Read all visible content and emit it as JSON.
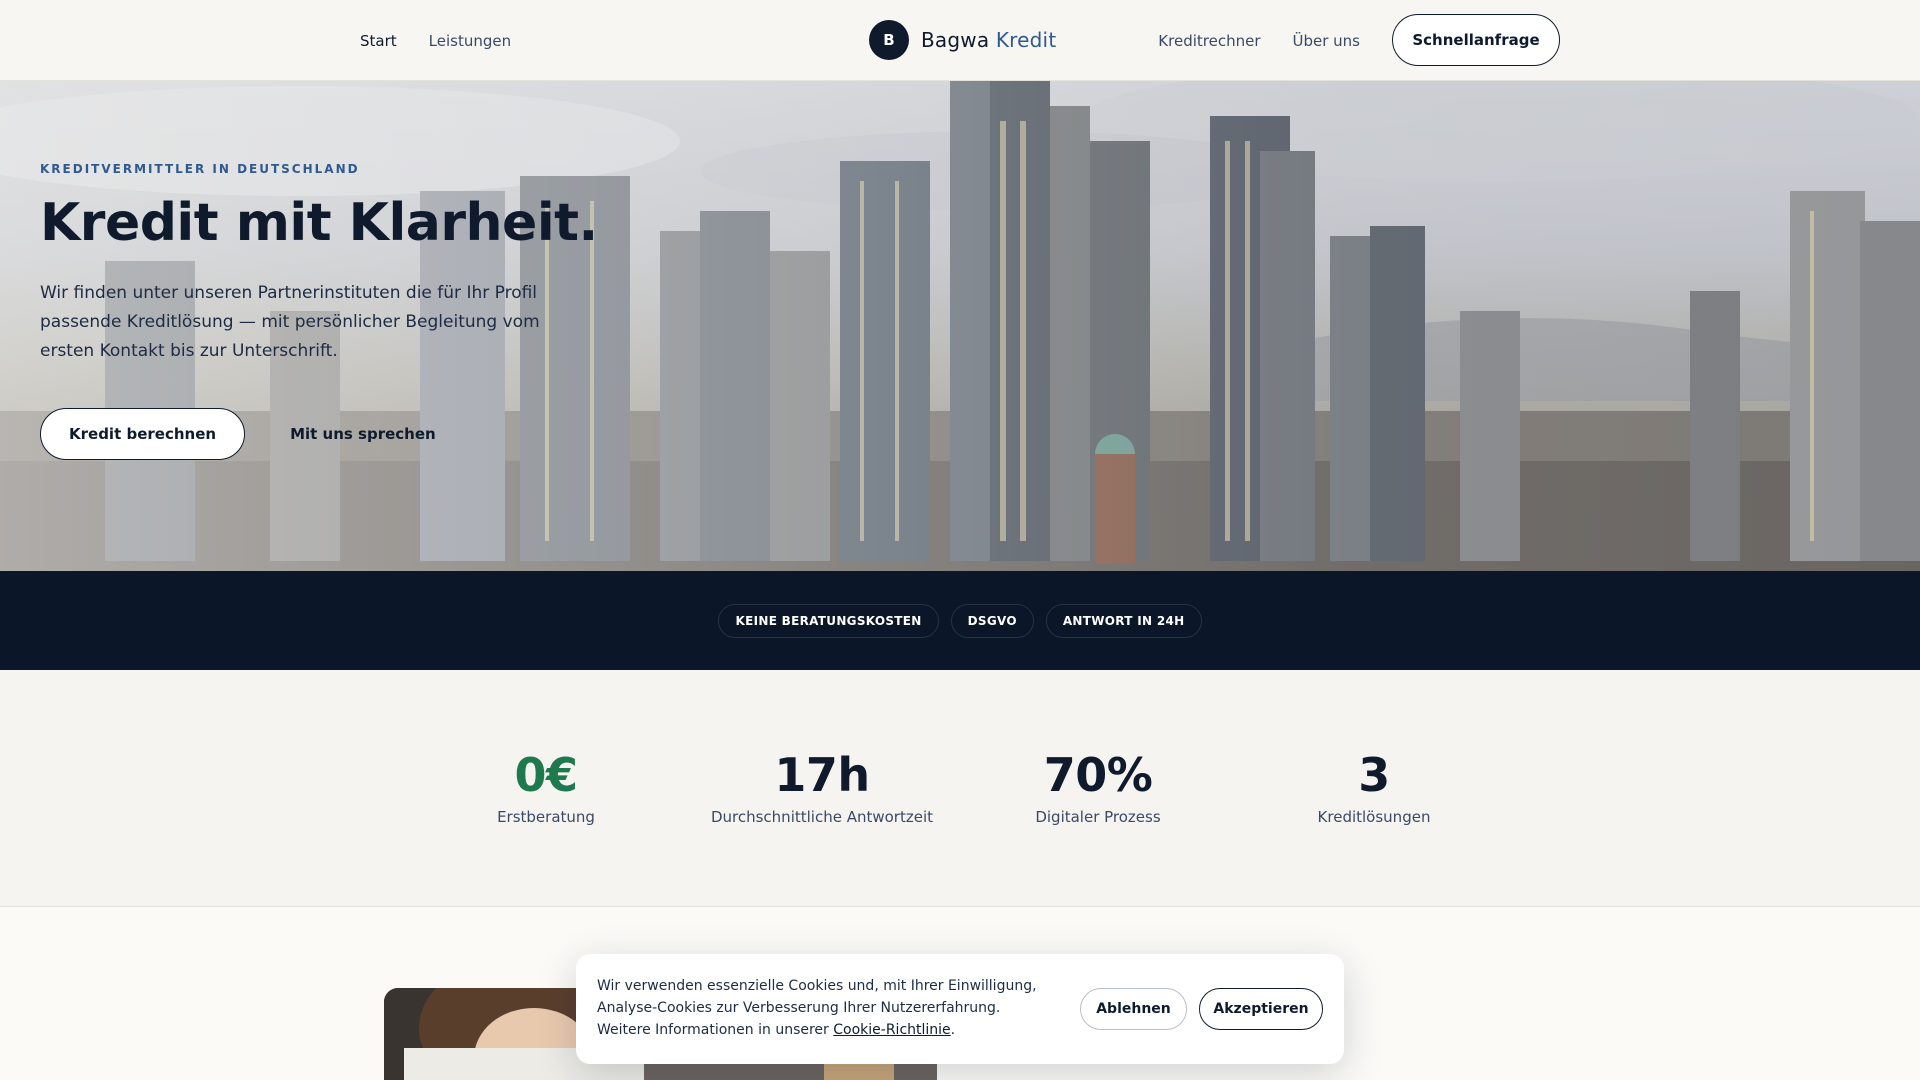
{
  "header": {
    "nav_left": [
      "Start",
      "Leistungen"
    ],
    "brand_badge": "B",
    "brand_name": "Bagwa",
    "brand_accent": "Kredit",
    "nav_right": [
      "Kreditrechner",
      "Über uns"
    ],
    "cta": "Schnellanfrage"
  },
  "hero": {
    "eyebrow": "KREDITVERMITTLER IN DEUTSCHLAND",
    "title": "Kredit mit Klarheit.",
    "text": "Wir finden unter unseren Partnerinstituten die für Ihr Profil passende Kreditlösung — mit persönlicher Begleitung vom ersten Kontakt bis zur Unterschrift.",
    "primary_button": "Kredit berechnen",
    "secondary_button": "Mit uns sprechen"
  },
  "trust": [
    "KEINE BERATUNGSKOSTEN",
    "DSGVO",
    "ANTWORT IN 24H"
  ],
  "stats": [
    {
      "value": "0€",
      "label": "Erstberatung"
    },
    {
      "value": "17h",
      "label": "Durchschnittliche Antwortzeit"
    },
    {
      "value": "70%",
      "label": "Digitaler Prozess"
    },
    {
      "value": "3",
      "label": "Kreditlösungen"
    }
  ],
  "cookie": {
    "text": "Wir verwenden essenzielle Cookies und, mit Ihrer Einwilligung, Analyse-Cookies zur Verbesserung Ihrer Nutzererfahrung. Weitere Informationen in unserer",
    "link": "Cookie-Richtlinie",
    "suffix": ".",
    "decline": "Ablehnen",
    "accept": "Akzeptieren"
  },
  "colors": {
    "navy": "#0f1b2d",
    "accent_blue": "#2f5a8f",
    "accent_green": "#1e7a4c",
    "trustbar_bg": "#0b1628"
  }
}
